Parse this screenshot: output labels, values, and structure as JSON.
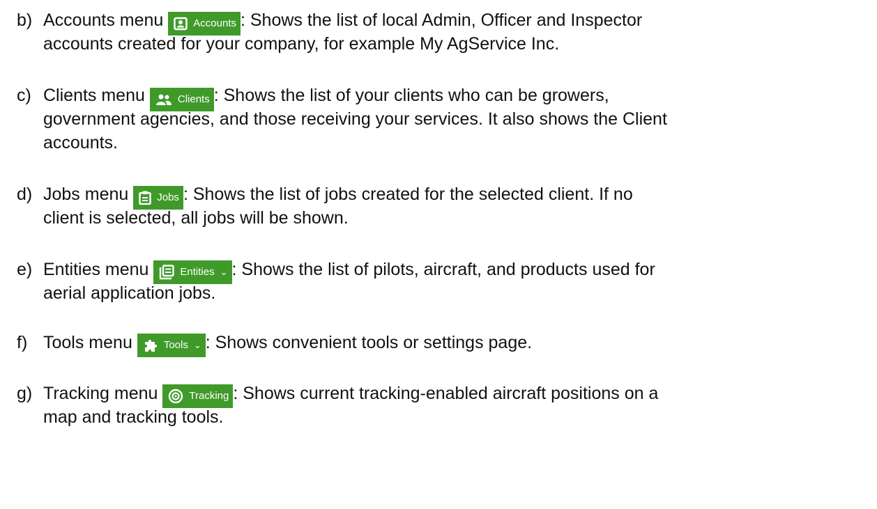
{
  "items": [
    {
      "marker": "b)",
      "menu_name": "Accounts menu",
      "button_label": "Accounts",
      "icon": "badge-icon",
      "desc_first": ":  Shows the list of local Admin, Officer and Inspector",
      "desc_cont": [
        "accounts created for your company, for example My AgService Inc."
      ]
    },
    {
      "marker": "c)",
      "menu_name": "Clients menu",
      "button_label": "Clients",
      "icon": "people-icon",
      "desc_first": ":  Shows the list of your clients who can be growers,",
      "desc_cont": [
        "government agencies, and those receiving your services. It also shows the Client",
        "accounts."
      ]
    },
    {
      "marker": "d)",
      "menu_name": "Jobs menu",
      "button_label": "Jobs",
      "icon": "clipboard-icon",
      "desc_first": ":  Shows the list of jobs created for the selected client. If no",
      "desc_cont": [
        "client is selected, all jobs will be shown."
      ]
    },
    {
      "marker": "e)",
      "menu_name": "Entities menu",
      "button_label": "Entities",
      "icon": "list-icon",
      "desc_first": ":  Shows the list of pilots, aircraft, and products used for",
      "desc_cont": [
        "aerial application jobs."
      ]
    },
    {
      "marker": "f)",
      "menu_name": "Tools menu",
      "button_label": "Tools",
      "icon": "puzzle-icon",
      "desc_first": ":  Shows convenient tools or settings page.",
      "desc_cont": []
    },
    {
      "marker": "g)",
      "menu_name": "Tracking menu",
      "button_label": "Tracking",
      "icon": "target-icon",
      "desc_first": ": Shows current tracking-enabled aircraft positions on a",
      "desc_cont": [
        "map and tracking tools."
      ]
    }
  ],
  "colors": {
    "button_bg": "#3f9a2a",
    "button_text": "#ffffff",
    "text": "#111111"
  }
}
